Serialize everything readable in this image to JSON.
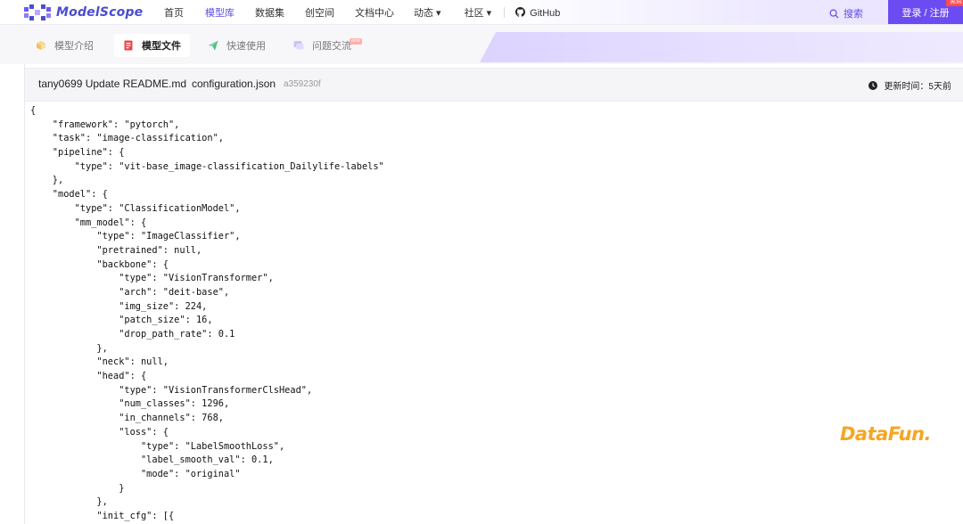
{
  "header": {
    "logo_text": "ModelScope",
    "nav": [
      {
        "label": "首页",
        "active": false
      },
      {
        "label": "模型库",
        "active": true
      },
      {
        "label": "数据集",
        "active": false
      },
      {
        "label": "创空间",
        "active": false
      },
      {
        "label": "文档中心",
        "active": false
      },
      {
        "label": "动态 ▾",
        "active": false
      },
      {
        "label": "社区 ▾",
        "active": false
      },
      {
        "label": "GitHub",
        "active": false
      }
    ],
    "search_label": "搜索",
    "login_label": "登录 / 注册",
    "free_badge": "免费",
    "colors": {
      "accent": "#5a4ee8",
      "login_bg": "#6c4cf2",
      "badge": "#ff4d4f"
    }
  },
  "tabs": [
    {
      "label": "模型介绍",
      "icon": "box-icon",
      "active": false
    },
    {
      "label": "模型文件",
      "icon": "file-icon",
      "active": true
    },
    {
      "label": "快速使用",
      "icon": "send-icon",
      "active": false
    },
    {
      "label": "问题交流",
      "icon": "chat-icon",
      "active": false
    }
  ],
  "tab_new_badge": "new",
  "file_header": {
    "commit_author": "tany0699 Update README.md",
    "file_name": "configuration.json",
    "commit_hash": "a359230f",
    "updated_label": "更新时间：5天前"
  },
  "code_lines": [
    "{",
    "    \"framework\": \"pytorch\",",
    "    \"task\": \"image-classification\",",
    "    \"pipeline\": {",
    "        \"type\": \"vit-base_image-classification_Dailylife-labels\"",
    "    },",
    "    \"model\": {",
    "        \"type\": \"ClassificationModel\",",
    "        \"mm_model\": {",
    "            \"type\": \"ImageClassifier\",",
    "            \"pretrained\": null,",
    "            \"backbone\": {",
    "                \"type\": \"VisionTransformer\",",
    "                \"arch\": \"deit-base\",",
    "                \"img_size\": 224,",
    "                \"patch_size\": 16,",
    "                \"drop_path_rate\": 0.1",
    "            },",
    "            \"neck\": null,",
    "            \"head\": {",
    "                \"type\": \"VisionTransformerClsHead\",",
    "                \"num_classes\": 1296,",
    "                \"in_channels\": 768,",
    "                \"loss\": {",
    "                    \"type\": \"LabelSmoothLoss\",",
    "                    \"label_smooth_val\": 0.1,",
    "                    \"mode\": \"original\"",
    "                }",
    "            },",
    "            \"init_cfg\": [{"
  ],
  "watermark": {
    "text": "DataFun.",
    "color": "#f5a623"
  }
}
